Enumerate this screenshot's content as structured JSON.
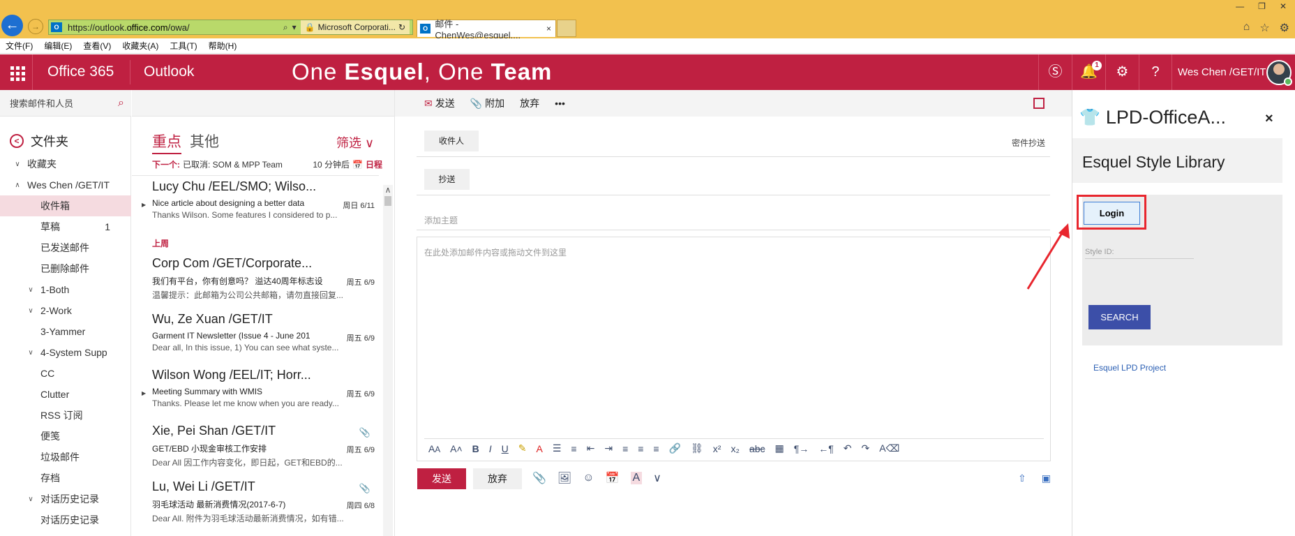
{
  "browser": {
    "url_prefix": "https://outlook.",
    "url_host": "office.com",
    "url_path": "/owa/",
    "cert_owner": "Microsoft Corporati...",
    "tab_title": "邮件 - ChenWes@esquel....",
    "tab_close": "×",
    "favicon": "O",
    "menu": [
      "文件(F)",
      "编辑(E)",
      "查看(V)",
      "收藏夹(A)",
      "工具(T)",
      "帮助(H)"
    ]
  },
  "suite": {
    "brand": "Office 365",
    "app": "Outlook",
    "slogan_a": "One ",
    "slogan_b": "Esquel",
    "slogan_c": ", One ",
    "slogan_d": "Team",
    "notif_count": "1",
    "user_name": "Wes Chen /GET/IT",
    "accent": "#bf2041"
  },
  "folders": {
    "search_placeholder": "搜索邮件和人员",
    "title": "文件夹",
    "items": [
      {
        "label": "收藏夹",
        "chev": "∨",
        "indent": 1
      },
      {
        "label": "Wes Chen /GET/IT",
        "chev": "∧",
        "indent": 1
      },
      {
        "label": "收件箱",
        "chev": "",
        "indent": 3,
        "selected": true
      },
      {
        "label": "草稿",
        "chev": "",
        "indent": 3,
        "count": "1"
      },
      {
        "label": "已发送邮件",
        "chev": "",
        "indent": 3
      },
      {
        "label": "已删除邮件",
        "chev": "",
        "indent": 3
      },
      {
        "label": "1-Both",
        "chev": "∨",
        "indent": 2
      },
      {
        "label": "2-Work",
        "chev": "∨",
        "indent": 2
      },
      {
        "label": "3-Yammer",
        "chev": "",
        "indent": 3
      },
      {
        "label": "4-System Supp",
        "chev": "∨",
        "indent": 2
      },
      {
        "label": "CC",
        "chev": "",
        "indent": 3
      },
      {
        "label": "Clutter",
        "chev": "",
        "indent": 3
      },
      {
        "label": "RSS 订阅",
        "chev": "",
        "indent": 3
      },
      {
        "label": "便笺",
        "chev": "",
        "indent": 3
      },
      {
        "label": "垃圾邮件",
        "chev": "",
        "indent": 3
      },
      {
        "label": "存档",
        "chev": "",
        "indent": 3
      },
      {
        "label": "对话历史记录",
        "chev": "∨",
        "indent": 2
      },
      {
        "label": "对话历史记录",
        "chev": "",
        "indent": 3
      }
    ]
  },
  "messages": {
    "pivot_focused": "重点",
    "pivot_other": "其他",
    "filter": "筛选",
    "next_label": "下一个:",
    "next_text": "已取消: SOM & MPP Team",
    "next_time": "10 分钟后",
    "next_cal": "日程",
    "group_last_week": "上周",
    "items": [
      {
        "from": "Lucy Chu /EEL/SMO; Wilso...",
        "subject": "Nice article about designing a better data",
        "preview": "Thanks Wilson. Some features I considered to p...",
        "date": "周日 6/11",
        "thread": true,
        "attach": false
      },
      {
        "from": "Corp Com /GET/Corporate...",
        "subject": "我们有平台，你有创意吗？ 溢达40周年标志设",
        "preview": "温馨提示：此邮箱为公司公共邮箱，请勿直接回复...",
        "date": "周五 6/9",
        "thread": false,
        "attach": false
      },
      {
        "from": "Wu, Ze Xuan /GET/IT",
        "subject": "Garment IT Newsletter (Issue 4 - June 201",
        "preview": "Dear all, In this issue, 1) You can see what syste...",
        "date": "周五 6/9",
        "thread": false,
        "attach": false
      },
      {
        "from": "Wilson Wong /EEL/IT; Horr...",
        "subject": "Meeting Summary with WMIS",
        "preview": "Thanks. Please let me know when you are ready...",
        "date": "周五 6/9",
        "thread": true,
        "attach": false
      },
      {
        "from": "Xie, Pei Shan /GET/IT",
        "subject": "GET/EBD 小现金审核工作安排",
        "preview": "Dear All 因工作内容变化，即日起，GET和EBD的...",
        "date": "周五 6/9",
        "thread": false,
        "attach": true
      },
      {
        "from": "Lu, Wei Li /GET/IT",
        "subject": "羽毛球活动 最新消费情况(2017-6-7)",
        "preview": "Dear All. 附件为羽毛球活动最新消费情况，如有错...",
        "date": "周四 6/8",
        "thread": false,
        "attach": true
      }
    ]
  },
  "compose": {
    "send": "发送",
    "attach": "附加",
    "discard": "放弃",
    "more": "•••",
    "to_label": "收件人",
    "cc_label": "抄送",
    "bcc_label": "密件抄送",
    "subject_placeholder": "添加主题",
    "body_placeholder": "在此处添加邮件内容或拖动文件到这里",
    "send_btn": "发送",
    "discard_btn": "放弃"
  },
  "addin": {
    "title": "LPD-OfficeA...",
    "close": "×",
    "library_title": "Esquel Style Library",
    "login": "Login",
    "style_id_placeholder": "Style ID:",
    "search": "SEARCH",
    "project_link": "Esquel LPD Project"
  }
}
